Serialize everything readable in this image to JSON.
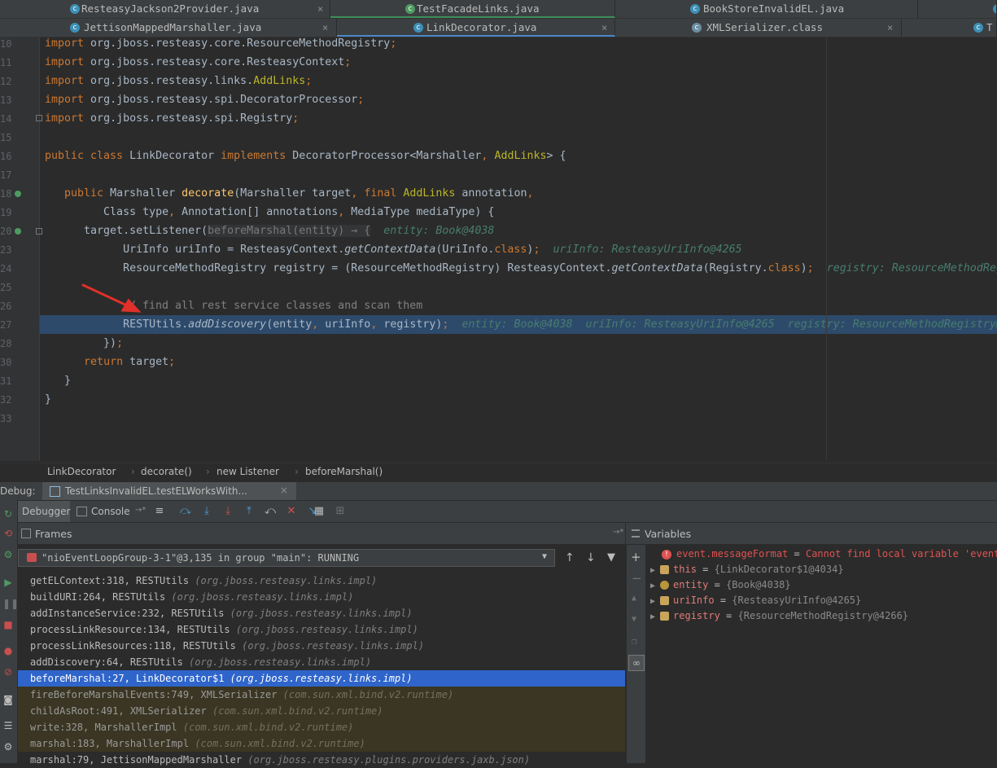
{
  "tabs_row1": [
    {
      "label": "ResteasyJackson2Provider.java",
      "icon": "java-class-icon"
    },
    {
      "label": "TestFacadeLinks.java",
      "icon": "java-class-icon"
    },
    {
      "label": "BookStoreInvalidEL.java",
      "icon": "java-class-icon"
    }
  ],
  "tabs_row2": [
    {
      "label": "JettisonMappedMarshaller.java",
      "icon": "java-class-icon"
    },
    {
      "label": "LinkDecorator.java",
      "icon": "java-class-icon"
    },
    {
      "label": "XMLSerializer.class",
      "icon": "class-file-icon"
    },
    {
      "label": "T",
      "icon": "java-class-icon"
    }
  ],
  "editor": {
    "line_numbers": [
      "10",
      "11",
      "12",
      "13",
      "14",
      "15",
      "16",
      "17",
      "18",
      "19",
      "20",
      "23",
      "24",
      "25",
      "26",
      "27",
      "28",
      "30",
      "31",
      "32",
      "33"
    ],
    "hints": {
      "line20": "entity: Book@4038",
      "line23": "uriInfo: ResteasyUriInfo@4265",
      "line24": "registry: ResourceMethodReg",
      "line27_entity": "entity: Book@4038",
      "line27_uri": "uriInfo: ResteasyUriInfo@4265",
      "line27_reg": "registry: ResourceMethodRegistry@"
    },
    "comment": "// find all rest service classes and scan them",
    "close_symbol": "×"
  },
  "breadcrumbs": [
    "LinkDecorator",
    "decorate()",
    "new Listener",
    "beforeMarshal()"
  ],
  "breadcrumb_sep": "›",
  "debug": {
    "label": "Debug:",
    "session_tab": "TestLinksInvalidEL.testELWorksWith...",
    "tab_debugger": "Debugger",
    "tab_console": "Console",
    "console_suffix": "→*",
    "frames_title": "Frames",
    "variables_title": "Variables",
    "frames_pin": "→*",
    "thread": "\"nioEventLoopGroup-3-1\"@3,135 in group \"main\": RUNNING"
  },
  "frames": [
    {
      "m": "getELContext:318, RESTUtils",
      "p": "(org.jboss.resteasy.links.impl)",
      "kind": "normal"
    },
    {
      "m": "buildURI:264, RESTUtils",
      "p": "(org.jboss.resteasy.links.impl)",
      "kind": "normal"
    },
    {
      "m": "addInstanceService:232, RESTUtils",
      "p": "(org.jboss.resteasy.links.impl)",
      "kind": "normal"
    },
    {
      "m": "processLinkResource:134, RESTUtils",
      "p": "(org.jboss.resteasy.links.impl)",
      "kind": "normal"
    },
    {
      "m": "processLinkResources:118, RESTUtils",
      "p": "(org.jboss.resteasy.links.impl)",
      "kind": "normal"
    },
    {
      "m": "addDiscovery:64, RESTUtils",
      "p": "(org.jboss.resteasy.links.impl)",
      "kind": "normal"
    },
    {
      "m": "beforeMarshal:27, LinkDecorator$1",
      "p": "(org.jboss.resteasy.links.impl)",
      "kind": "sel"
    },
    {
      "m": "fireBeforeMarshalEvents:749, XMLSerializer",
      "p": "(com.sun.xml.bind.v2.runtime)",
      "kind": "lib"
    },
    {
      "m": "childAsRoot:491, XMLSerializer",
      "p": "(com.sun.xml.bind.v2.runtime)",
      "kind": "lib"
    },
    {
      "m": "write:328, MarshallerImpl",
      "p": "(com.sun.xml.bind.v2.runtime)",
      "kind": "lib"
    },
    {
      "m": "marshal:183, MarshallerImpl",
      "p": "(com.sun.xml.bind.v2.runtime)",
      "kind": "lib"
    },
    {
      "m": "marshal:79, JettisonMappedMarshaller",
      "p": "(org.jboss.resteasy.plugins.providers.jaxb.json)",
      "kind": "normal"
    }
  ],
  "variables": [
    {
      "name": "event.messageFormat",
      "eq": " = ",
      "value": "Cannot find local variable 'event'",
      "type": "error"
    },
    {
      "name": "this",
      "eq": " = ",
      "value": "{LinkDecorator$1@4034}",
      "type": "field"
    },
    {
      "name": "entity",
      "eq": " = ",
      "value": "{Book@4038}",
      "type": "param"
    },
    {
      "name": "uriInfo",
      "eq": " = ",
      "value": "{ResteasyUriInfo@4265}",
      "type": "field"
    },
    {
      "name": "registry",
      "eq": " = ",
      "value": "{ResourceMethodRegistry@4266}",
      "type": "field"
    }
  ],
  "colors": {
    "selection": "#2f65ca",
    "exec_line": "#2d4a6b",
    "annotation_arrow": "#e0302a",
    "error": "#e05252"
  }
}
